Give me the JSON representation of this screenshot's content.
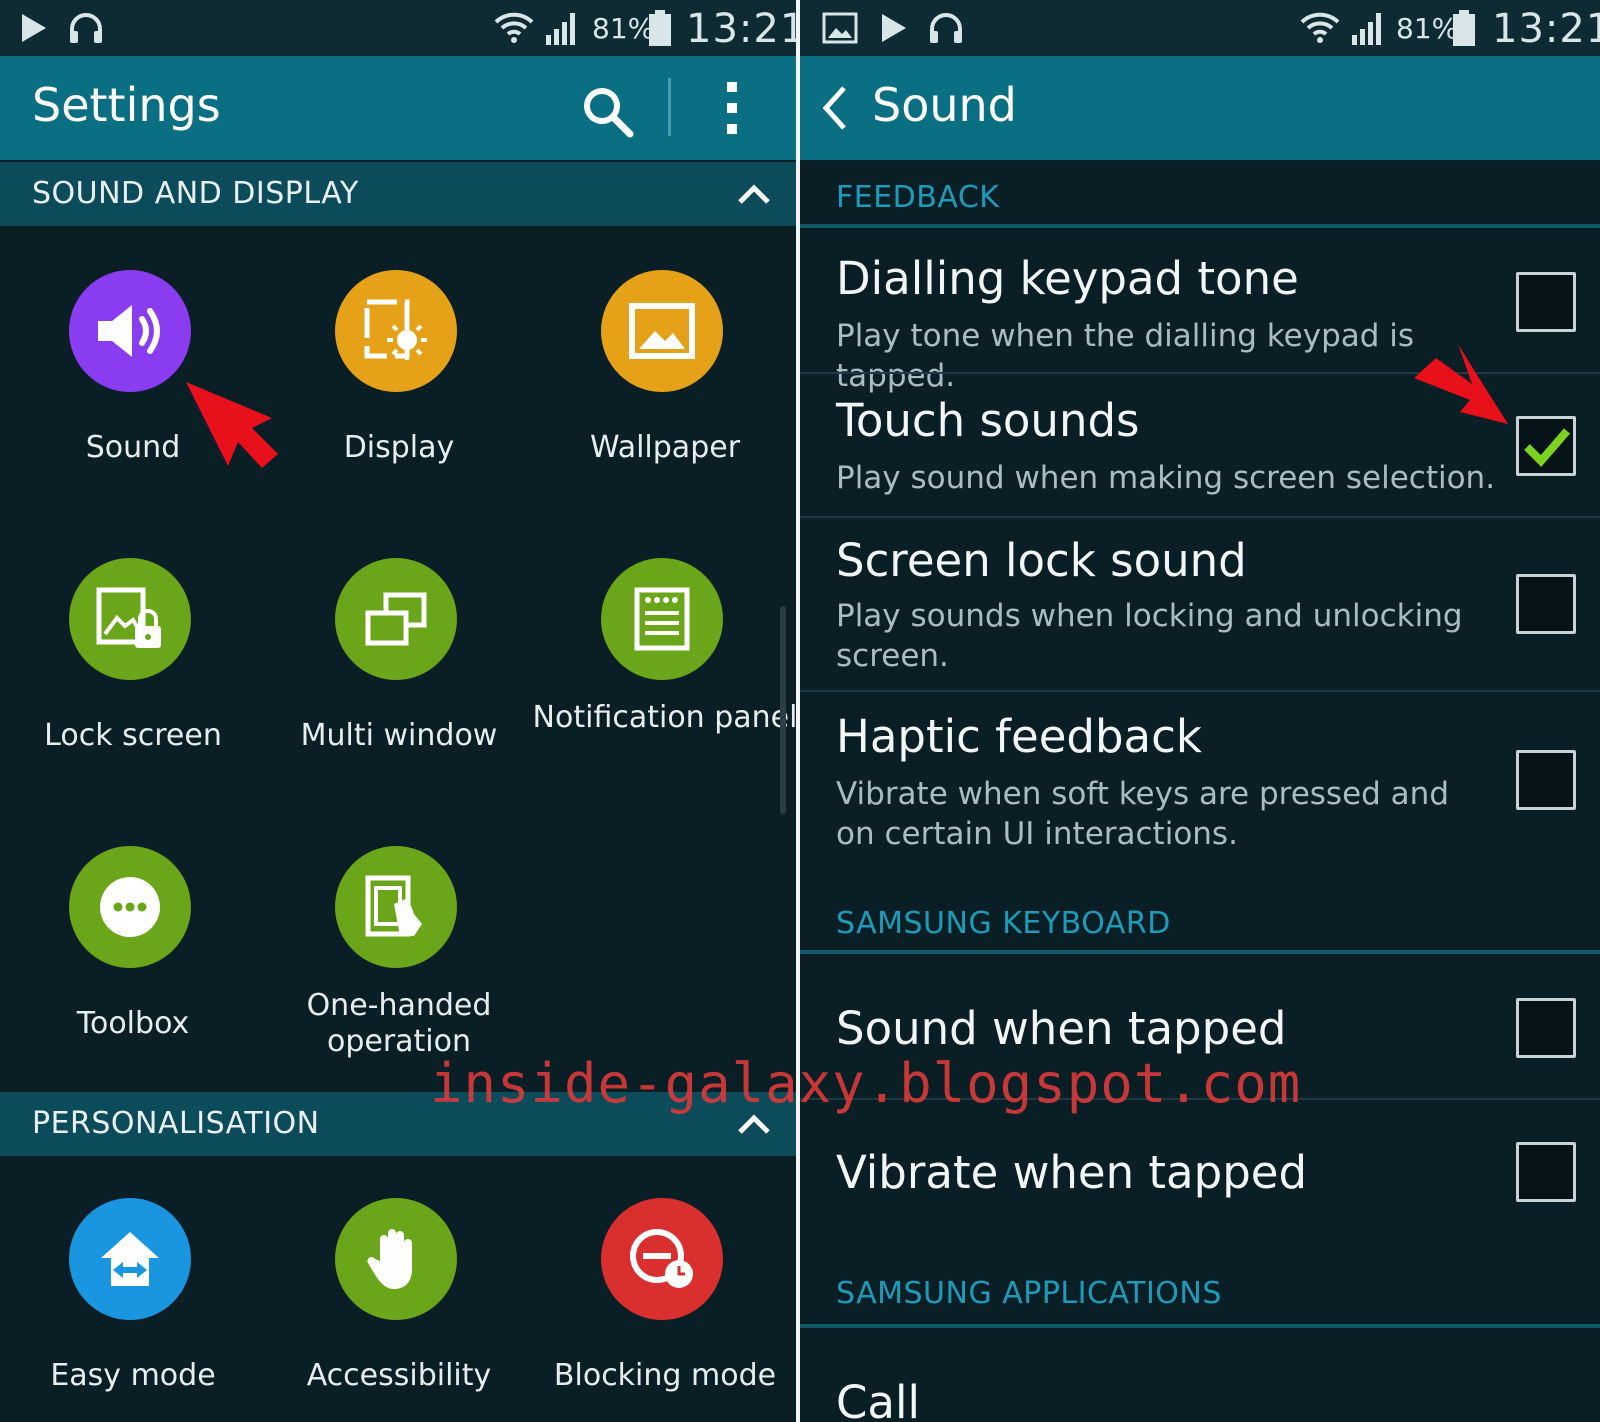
{
  "status_bar": {
    "battery": "81%",
    "time": "13:21"
  },
  "left": {
    "title": "Settings",
    "sections": [
      {
        "header": "SOUND AND DISPLAY",
        "items": [
          {
            "label": "Sound",
            "icon": "speaker-icon",
            "color": "#8a3df0"
          },
          {
            "label": "Display",
            "icon": "display-brightness-icon",
            "color": "#e5a117"
          },
          {
            "label": "Wallpaper",
            "icon": "picture-icon",
            "color": "#e5a117"
          },
          {
            "label": "Lock screen",
            "icon": "lock-screen-icon",
            "color": "#6aa51a"
          },
          {
            "label": "Multi window",
            "icon": "multi-window-icon",
            "color": "#6aa51a"
          },
          {
            "label": "Notification panel",
            "icon": "notification-panel-icon",
            "color": "#6aa51a"
          },
          {
            "label": "Toolbox",
            "icon": "toolbox-dots-icon",
            "color": "#6aa51a"
          },
          {
            "label": "One-handed operation",
            "icon": "one-handed-icon",
            "color": "#6aa51a"
          }
        ]
      },
      {
        "header": "PERSONALISATION",
        "items": [
          {
            "label": "Easy mode",
            "icon": "easy-mode-home-icon",
            "color": "#1a95e0"
          },
          {
            "label": "Accessibility",
            "icon": "hand-icon",
            "color": "#6aa51a"
          },
          {
            "label": "Blocking mode",
            "icon": "blocking-mode-icon",
            "color": "#d9302f"
          }
        ]
      }
    ]
  },
  "right": {
    "title": "Sound",
    "sections": [
      {
        "header": "FEEDBACK",
        "rows": [
          {
            "title": "Dialling keypad tone",
            "desc": "Play tone when the dialling keypad is tapped.",
            "checked": false
          },
          {
            "title": "Touch sounds",
            "desc": "Play sound when making screen selection.",
            "checked": true
          },
          {
            "title": "Screen lock sound",
            "desc": "Play sounds when locking and unlocking screen.",
            "checked": false
          },
          {
            "title": "Haptic feedback",
            "desc": "Vibrate when soft keys are pressed and on certain UI interactions.",
            "checked": false
          }
        ]
      },
      {
        "header": "SAMSUNG KEYBOARD",
        "rows": [
          {
            "title": "Sound when tapped",
            "checked": false
          },
          {
            "title": "Vibrate when tapped",
            "checked": false
          }
        ]
      },
      {
        "header": "SAMSUNG APPLICATIONS",
        "rows": [
          {
            "title": "Call"
          }
        ]
      }
    ]
  },
  "watermark": "inside-galaxy.blogspot.com",
  "colors": {
    "accent": "#0b6f83",
    "section_text": "#1d9cba",
    "check": "#7ed321",
    "arrow": "#e8101a"
  }
}
